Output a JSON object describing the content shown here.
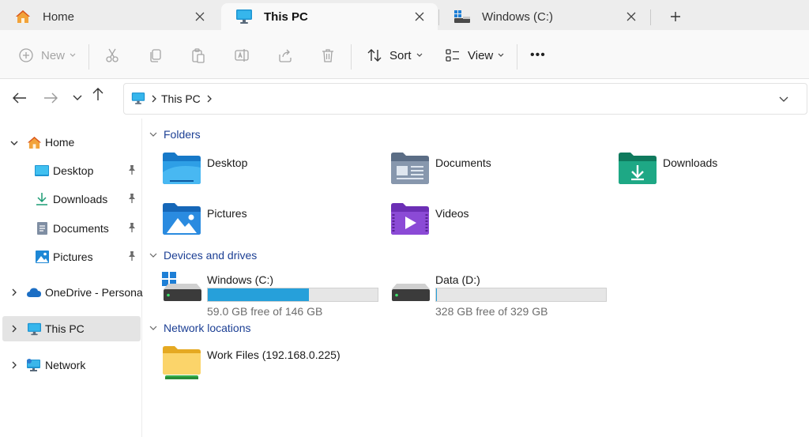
{
  "tabs": [
    {
      "label": "Home",
      "icon": "home-icon"
    },
    {
      "label": "This PC",
      "icon": "computer-icon",
      "active": true
    },
    {
      "label": "Windows (C:)",
      "icon": "drive-icon"
    }
  ],
  "toolbar": {
    "new_label": "New",
    "sort_label": "Sort",
    "view_label": "View",
    "more_label": "•••"
  },
  "address": {
    "crumbs": [
      "This PC"
    ]
  },
  "sidebar": {
    "items": [
      {
        "label": "Home",
        "icon": "home-icon"
      },
      {
        "label": "Desktop",
        "icon": "desktop-folder-icon",
        "pinned": true
      },
      {
        "label": "Downloads",
        "icon": "download-icon",
        "pinned": true
      },
      {
        "label": "Documents",
        "icon": "documents-icon",
        "pinned": true
      },
      {
        "label": "Pictures",
        "icon": "pictures-icon",
        "pinned": true
      },
      {
        "label": "OneDrive - Personal",
        "icon": "cloud-icon"
      },
      {
        "label": "This PC",
        "icon": "computer-icon",
        "selected": true
      },
      {
        "label": "Network",
        "icon": "network-icon"
      }
    ]
  },
  "sections": {
    "folders": {
      "title": "Folders",
      "items": [
        {
          "label": "Desktop",
          "icon": "desktop-folder-icon"
        },
        {
          "label": "Documents",
          "icon": "documents-folder-icon"
        },
        {
          "label": "Downloads",
          "icon": "downloads-folder-icon"
        },
        {
          "label": "Pictures",
          "icon": "pictures-folder-icon"
        },
        {
          "label": "Videos",
          "icon": "videos-folder-icon"
        }
      ]
    },
    "drives": {
      "title": "Devices and drives",
      "items": [
        {
          "label": "Windows (C:)",
          "free_text": "59.0 GB free of 146 GB",
          "used_fraction": 0.596
        },
        {
          "label": "Data (D:)",
          "free_text": "328 GB free of 329 GB",
          "used_fraction": 0.003
        }
      ]
    },
    "network": {
      "title": "Network locations",
      "items": [
        {
          "label": "Work Files (192.168.0.225)",
          "icon": "network-folder-icon"
        }
      ]
    }
  },
  "colors": {
    "accent": "#26a0da",
    "section_header": "#1c3f94",
    "selected_bg": "#e4e4e4"
  }
}
